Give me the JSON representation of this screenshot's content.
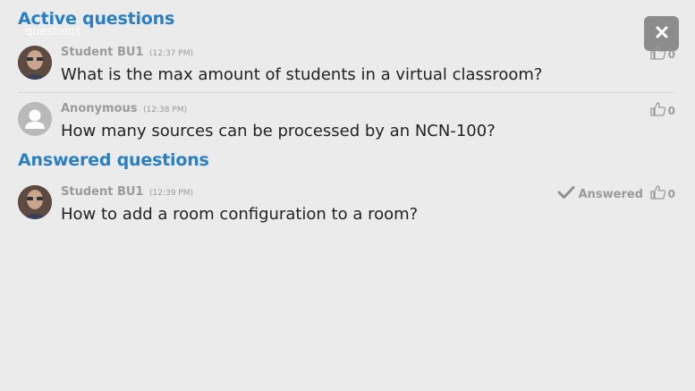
{
  "header": {
    "active_title": "Active questions",
    "ghost_label": "questions",
    "answered_title": "Answered questions"
  },
  "close_button": {
    "icon": "close-icon"
  },
  "active_questions": [
    {
      "author": "Student BU1",
      "time": "(12:37 PM)",
      "text": "What is the max amount of students in a virtual classroom?",
      "likes": "0",
      "avatar": "photo"
    },
    {
      "author": "Anonymous",
      "time": "(12:38 PM)",
      "text": "How many sources can be processed by an NCN-100?",
      "likes": "0",
      "avatar": "anonymous"
    }
  ],
  "answered_questions": [
    {
      "author": "Student BU1",
      "time": "(12:39 PM)",
      "text": "How to add a room configuration to a room?",
      "status": "Answered",
      "likes": "0",
      "avatar": "photo"
    }
  ],
  "colors": {
    "accent": "#2a7fc4",
    "background": "#ebebeb",
    "muted": "#9a9a9a"
  }
}
